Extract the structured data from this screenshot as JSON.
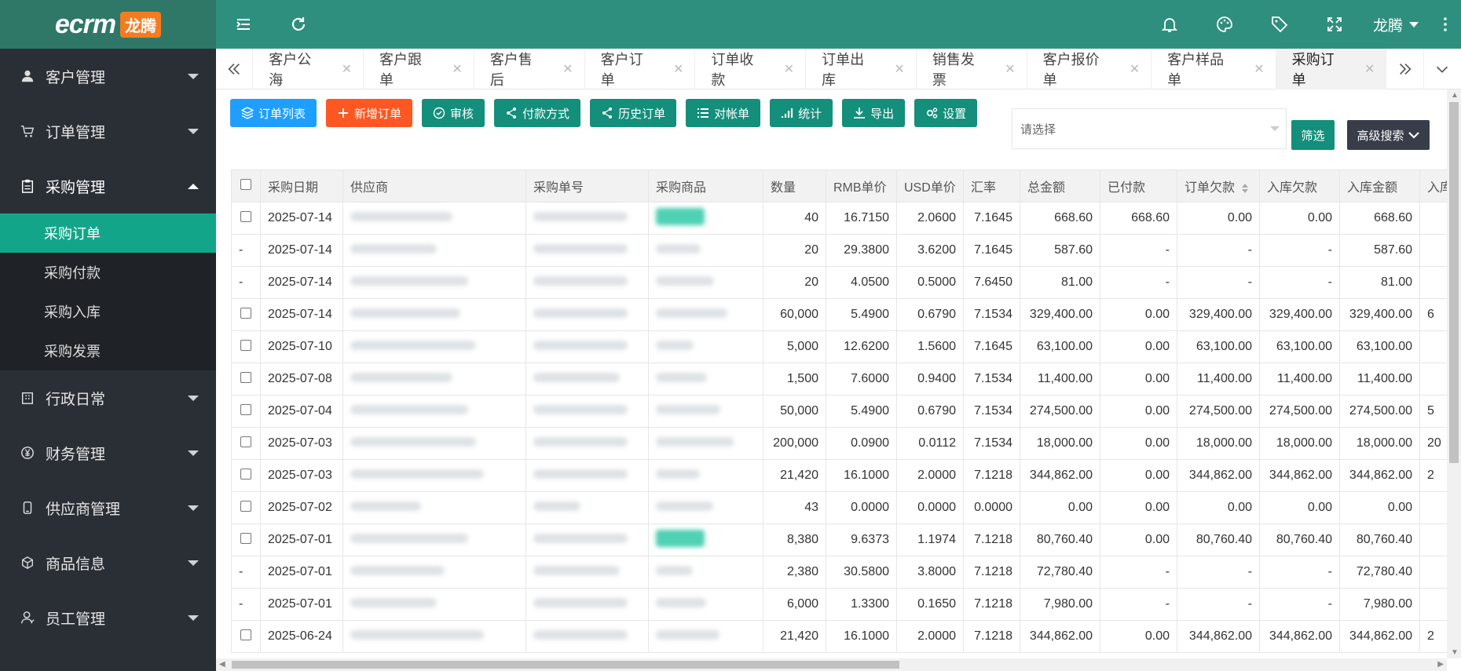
{
  "brand": {
    "logo_text": "ecrm",
    "logo_badge": "龙腾"
  },
  "sidebar": {
    "items": [
      {
        "label": "客户管理",
        "icon": "user-icon"
      },
      {
        "label": "订单管理",
        "icon": "cart-icon"
      },
      {
        "label": "采购管理",
        "icon": "clipboard-icon",
        "open": true
      },
      {
        "label": "行政日常",
        "icon": "building-icon"
      },
      {
        "label": "财务管理",
        "icon": "yen-icon"
      },
      {
        "label": "供应商管理",
        "icon": "phone-icon"
      },
      {
        "label": "商品信息",
        "icon": "box-icon"
      },
      {
        "label": "员工管理",
        "icon": "staff-icon"
      }
    ],
    "subitems": [
      "采购订单",
      "采购付款",
      "采购入库",
      "采购发票"
    ]
  },
  "header": {
    "user": "龙腾"
  },
  "tabs": [
    "客户公海",
    "客户跟单",
    "客户售后",
    "客户订单",
    "订单收款",
    "订单出库",
    "销售发票",
    "客户报价单",
    "客户样品单",
    "采购订单"
  ],
  "toolbar": {
    "order_list": "订单列表",
    "new_order": "新增订单",
    "audit": "审核",
    "payment_method": "付款方式",
    "history_order": "历史订单",
    "statement": "对帐单",
    "stats": "统计",
    "export": "导出",
    "settings": "设置"
  },
  "filter": {
    "placeholder": "请选择",
    "filter_btn": "筛选",
    "advanced_btn": "高级搜索"
  },
  "table": {
    "headers": [
      "采购日期",
      "供应商",
      "采购单号",
      "采购商品",
      "数量",
      "RMB单价",
      "USD单价",
      "汇率",
      "总金额",
      "已付款",
      "订单欠款",
      "入库欠款",
      "入库金额",
      "入库"
    ],
    "rows": [
      {
        "sel": "cb",
        "date": "2025-07-14",
        "tag": true,
        "qty": "40",
        "rmb": "16.7150",
        "usd": "2.0600",
        "rate": "7.1645",
        "total": "668.60",
        "paid": "668.60",
        "owe": "0.00",
        "in_owe": "0.00",
        "in_amt": "668.60",
        "extra": ""
      },
      {
        "sel": "-",
        "date": "2025-07-14",
        "tag": false,
        "qty": "20",
        "rmb": "29.3800",
        "usd": "3.6200",
        "rate": "7.1645",
        "total": "587.60",
        "paid": "-",
        "owe": "-",
        "in_owe": "-",
        "in_amt": "587.60",
        "extra": ""
      },
      {
        "sel": "-",
        "date": "2025-07-14",
        "tag": false,
        "qty": "20",
        "rmb": "4.0500",
        "usd": "0.5000",
        "rate": "7.6450",
        "total": "81.00",
        "paid": "-",
        "owe": "-",
        "in_owe": "-",
        "in_amt": "81.00",
        "extra": ""
      },
      {
        "sel": "cb",
        "date": "2025-07-14",
        "tag": false,
        "qty": "60,000",
        "rmb": "5.4900",
        "usd": "0.6790",
        "rate": "7.1534",
        "total": "329,400.00",
        "paid": "0.00",
        "owe": "329,400.00",
        "in_owe": "329,400.00",
        "in_amt": "329,400.00",
        "extra": "6"
      },
      {
        "sel": "cb",
        "date": "2025-07-10",
        "tag": false,
        "qty": "5,000",
        "rmb": "12.6200",
        "usd": "1.5600",
        "rate": "7.1645",
        "total": "63,100.00",
        "paid": "0.00",
        "owe": "63,100.00",
        "in_owe": "63,100.00",
        "in_amt": "63,100.00",
        "extra": ""
      },
      {
        "sel": "cb",
        "date": "2025-07-08",
        "tag": false,
        "qty": "1,500",
        "rmb": "7.6000",
        "usd": "0.9400",
        "rate": "7.1534",
        "total": "11,400.00",
        "paid": "0.00",
        "owe": "11,400.00",
        "in_owe": "11,400.00",
        "in_amt": "11,400.00",
        "extra": ""
      },
      {
        "sel": "cb",
        "date": "2025-07-04",
        "tag": false,
        "qty": "50,000",
        "rmb": "5.4900",
        "usd": "0.6790",
        "rate": "7.1534",
        "total": "274,500.00",
        "paid": "0.00",
        "owe": "274,500.00",
        "in_owe": "274,500.00",
        "in_amt": "274,500.00",
        "extra": "5"
      },
      {
        "sel": "cb",
        "date": "2025-07-03",
        "tag": false,
        "qty": "200,000",
        "rmb": "0.0900",
        "usd": "0.0112",
        "rate": "7.1534",
        "total": "18,000.00",
        "paid": "0.00",
        "owe": "18,000.00",
        "in_owe": "18,000.00",
        "in_amt": "18,000.00",
        "extra": "20"
      },
      {
        "sel": "cb",
        "date": "2025-07-03",
        "tag": false,
        "qty": "21,420",
        "rmb": "16.1000",
        "usd": "2.0000",
        "rate": "7.1218",
        "total": "344,862.00",
        "paid": "0.00",
        "owe": "344,862.00",
        "in_owe": "344,862.00",
        "in_amt": "344,862.00",
        "extra": "2"
      },
      {
        "sel": "cb",
        "date": "2025-07-02",
        "tag": false,
        "qty": "43",
        "rmb": "0.0000",
        "usd": "0.0000",
        "rate": "0.0000",
        "total": "0.00",
        "paid": "0.00",
        "owe": "0.00",
        "in_owe": "0.00",
        "in_amt": "0.00",
        "extra": ""
      },
      {
        "sel": "cb",
        "date": "2025-07-01",
        "tag": true,
        "qty": "8,380",
        "rmb": "9.6373",
        "usd": "1.1974",
        "rate": "7.1218",
        "total": "80,760.40",
        "paid": "0.00",
        "owe": "80,760.40",
        "in_owe": "80,760.40",
        "in_amt": "80,760.40",
        "extra": ""
      },
      {
        "sel": "-",
        "date": "2025-07-01",
        "tag": false,
        "qty": "2,380",
        "rmb": "30.5800",
        "usd": "3.8000",
        "rate": "7.1218",
        "total": "72,780.40",
        "paid": "-",
        "owe": "-",
        "in_owe": "-",
        "in_amt": "72,780.40",
        "extra": ""
      },
      {
        "sel": "-",
        "date": "2025-07-01",
        "tag": false,
        "qty": "6,000",
        "rmb": "1.3300",
        "usd": "0.1650",
        "rate": "7.1218",
        "total": "7,980.00",
        "paid": "-",
        "owe": "-",
        "in_owe": "-",
        "in_amt": "7,980.00",
        "extra": ""
      },
      {
        "sel": "cb",
        "date": "2025-06-24",
        "tag": false,
        "qty": "21,420",
        "rmb": "16.1000",
        "usd": "2.0000",
        "rate": "7.1218",
        "total": "344,862.00",
        "paid": "0.00",
        "owe": "344,862.00",
        "in_owe": "344,862.00",
        "in_amt": "344,862.00",
        "extra": "2"
      }
    ]
  },
  "colors": {
    "sidebar": "#2a2f36",
    "header": "#2f8f7e",
    "active": "#13a58a",
    "accent_blue": "#1e9fff",
    "accent_orange": "#ff5722",
    "btn_green": "#138f7c"
  }
}
